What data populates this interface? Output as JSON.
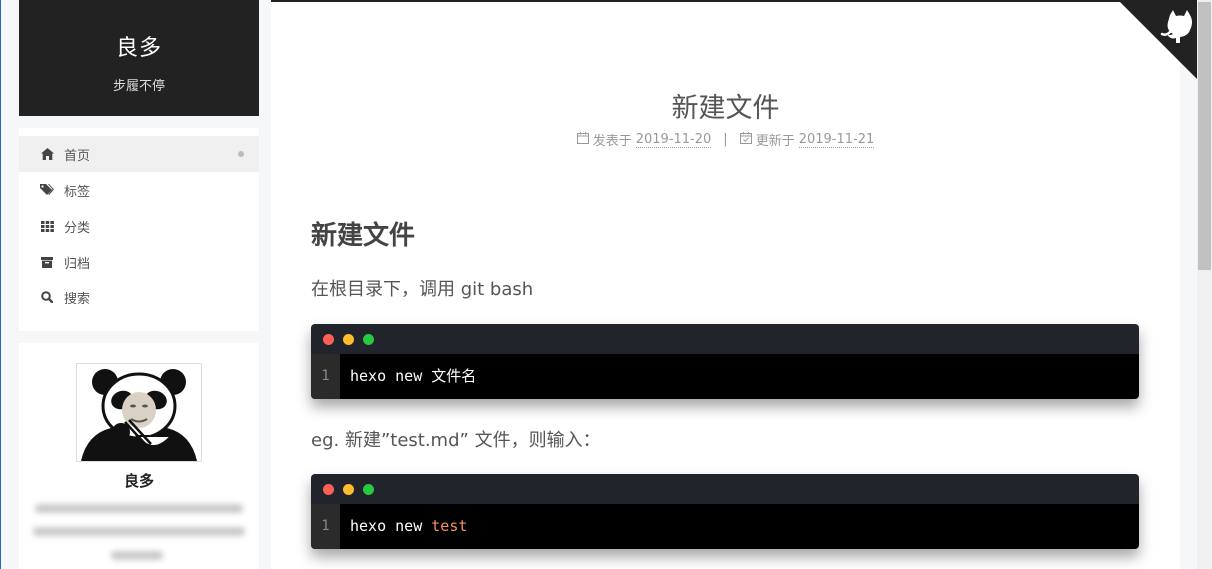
{
  "site": {
    "title": "良多",
    "subtitle": "步履不停"
  },
  "menu": [
    {
      "label": "首页",
      "icon": "home-icon",
      "active": true
    },
    {
      "label": "标签",
      "icon": "tags-icon"
    },
    {
      "label": "分类",
      "icon": "grid-icon"
    },
    {
      "label": "归档",
      "icon": "archive-icon"
    },
    {
      "label": "搜索",
      "icon": "search-icon"
    }
  ],
  "author": {
    "name": "良多",
    "avatar": "panda-meme-avatar"
  },
  "post": {
    "title": "新建文件",
    "meta": {
      "published_label": "发表于",
      "published_date": "2019-11-20",
      "separator": "|",
      "updated_label": "更新于",
      "updated_date": "2019-11-21"
    },
    "heading": "新建文件",
    "para1": "在根目录下，调用 git bash",
    "code1": {
      "line_no": "1",
      "cmd": "hexo new ",
      "arg": "文件名"
    },
    "para2": "eg. 新建”test.md” 文件，则输入：",
    "code2": {
      "line_no": "1",
      "cmd": "hexo new ",
      "arg": "test"
    }
  },
  "corner_icon": "github-octocat-icon",
  "colors": {
    "brand_bg": "#222222",
    "code_bar": "#21252b",
    "light_red": "#ff5f56",
    "light_yellow": "#ffbd2e",
    "light_green": "#27c93f",
    "string": "#f99157"
  }
}
